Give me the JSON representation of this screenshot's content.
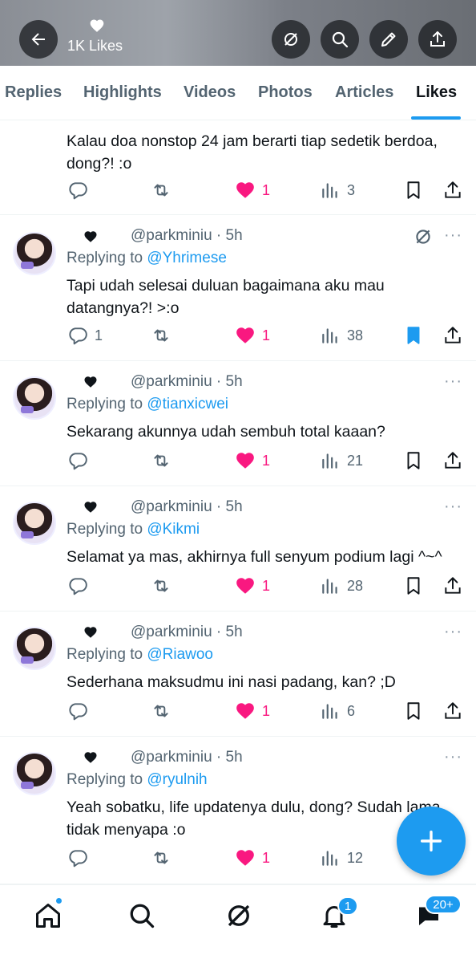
{
  "header": {
    "likes_label": "1K Likes"
  },
  "tabs": [
    {
      "label": "Replies"
    },
    {
      "label": "Highlights"
    },
    {
      "label": "Videos"
    },
    {
      "label": "Photos"
    },
    {
      "label": "Articles"
    },
    {
      "label": "Likes"
    }
  ],
  "posts": [
    {
      "text": "Kalau doa nonstop 24 jam berarti tiap sedetik berdoa, dong?! :o",
      "likes": "1",
      "views": "3"
    },
    {
      "handle": "@parkminiu · 5h",
      "replying_prefix": "Replying to",
      "replying_to": "@Yhrimese",
      "text": "Tapi udah selesai duluan bagaimana aku mau datangnya?! >:o",
      "replies": "1",
      "likes": "1",
      "views": "38"
    },
    {
      "handle": "@parkminiu · 5h",
      "replying_prefix": "Replying to",
      "replying_to": "@tianxicwei",
      "text": "Sekarang akunnya udah sembuh total kaaan?",
      "likes": "1",
      "views": "21"
    },
    {
      "handle": "@parkminiu · 5h",
      "replying_prefix": "Replying to",
      "replying_to": "@Kikmi",
      "text": "Selamat ya mas, akhirnya full senyum podium lagi ^~^",
      "likes": "1",
      "views": "28"
    },
    {
      "handle": "@parkminiu · 5h",
      "replying_prefix": "Replying to",
      "replying_to": "@Riawoo",
      "text": "Sederhana maksudmu ini nasi padang, kan? ;D",
      "likes": "1",
      "views": "6"
    },
    {
      "handle": "@parkminiu · 5h",
      "replying_prefix": "Replying to",
      "replying_to": "@ryulnih",
      "text": "Yeah sobatku, life updatenya dulu, dong? Sudah lama tidak menyapa :o",
      "likes": "1",
      "views": "12"
    }
  ],
  "more_glyph": "···",
  "nav": {
    "notif_badge": "1",
    "msg_badge": "20+"
  },
  "colors": {
    "accent": "#1d9bf0",
    "like": "#f91880",
    "text": "#0f1419",
    "muted": "#536471"
  }
}
